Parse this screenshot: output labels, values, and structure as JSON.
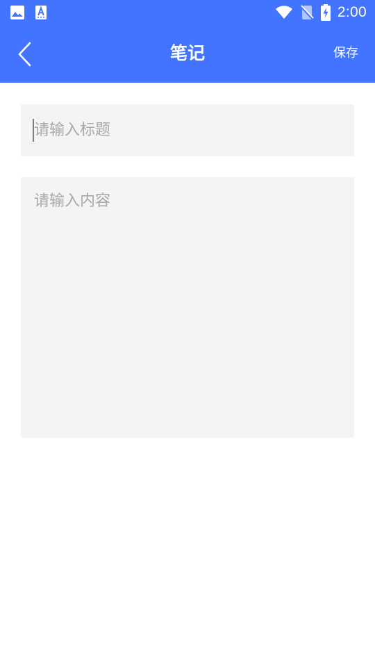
{
  "status_bar": {
    "time": "2:00",
    "icons": [
      "image-icon",
      "text-a-icon",
      "wifi-icon",
      "no-sim-icon",
      "battery-charging-icon"
    ]
  },
  "navbar": {
    "title": "笔记",
    "back_icon": "chevron-left-icon",
    "save_label": "保存"
  },
  "form": {
    "title_placeholder": "请输入标题",
    "title_value": "",
    "content_placeholder": "请输入内容",
    "content_value": ""
  },
  "colors": {
    "primary": "#4374FF",
    "field_background": "#F4F4F4",
    "placeholder": "#A8A8A8"
  }
}
